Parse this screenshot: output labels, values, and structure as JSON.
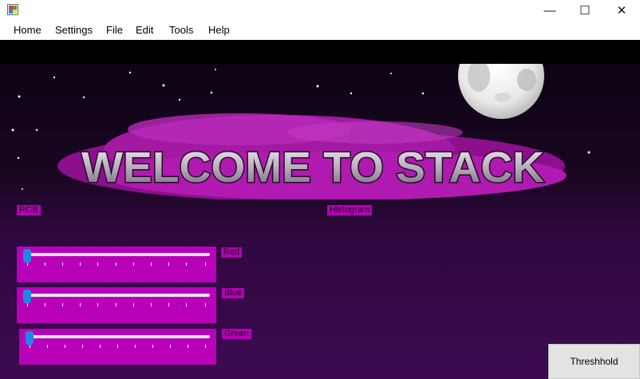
{
  "window": {
    "icon": "app-form-icon",
    "controls": {
      "minimize": "—",
      "maximize": "☐",
      "close": "✕"
    }
  },
  "menu": [
    "Home",
    "Settings",
    "File",
    "Edit",
    "Tools",
    "Help"
  ],
  "banner": {
    "title": "WELCOME TO STACK"
  },
  "groups": {
    "rgb": "RGB",
    "histogram": "Histogram"
  },
  "sliders": [
    {
      "label": "Red",
      "value": 0
    },
    {
      "label": "Blue",
      "value": 0
    },
    {
      "label": "Green",
      "value": 0
    }
  ],
  "buttons": {
    "threshold": "Threshhold"
  },
  "colors": {
    "panel": "#b900b9",
    "accent": "#1e88e5",
    "background": "#300840"
  }
}
